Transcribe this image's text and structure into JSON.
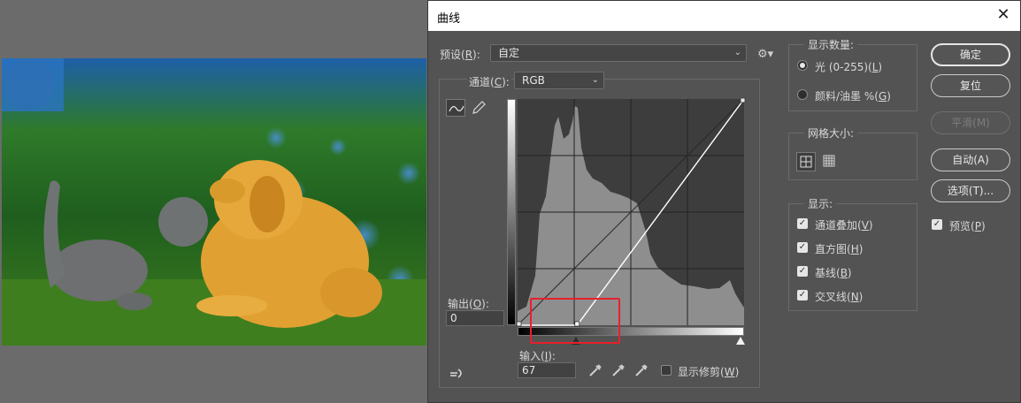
{
  "dialog": {
    "title": "曲线",
    "close_glyph": "✕",
    "preset": {
      "label": "预设(",
      "key": "R",
      "label_end": "):",
      "value": "自定"
    },
    "channel": {
      "label": "通道(",
      "key": "C",
      "label_end": "):",
      "value": "RGB"
    },
    "output": {
      "label": "输出(",
      "key": "O",
      "label_end": "):",
      "value": "0"
    },
    "input": {
      "label": "输入(",
      "key": "I",
      "label_end": "):",
      "value": "67"
    },
    "show_clipping": {
      "label": "显示修剪(",
      "key": "W",
      "label_end": ")",
      "checked": false
    },
    "display_amount": {
      "title": "显示数量:",
      "options": [
        {
          "label": "光 (0-255)(",
          "key": "L",
          "label_end": ")",
          "selected": true
        },
        {
          "label": "颜料/油墨 %(",
          "key": "G",
          "label_end": ")",
          "selected": false
        }
      ]
    },
    "grid_size": {
      "title": "网格大小:"
    },
    "show": {
      "title": "显示:",
      "items": [
        {
          "label": "通道叠加(",
          "key": "V",
          "label_end": ")",
          "checked": true
        },
        {
          "label": "直方图(",
          "key": "H",
          "label_end": ")",
          "checked": true
        },
        {
          "label": "基线(",
          "key": "B",
          "label_end": ")",
          "checked": true
        },
        {
          "label": "交叉线(",
          "key": "N",
          "label_end": ")",
          "checked": true
        }
      ]
    },
    "buttons": {
      "ok": "确定",
      "reset": "复位",
      "smooth": "平滑(M)",
      "auto": "自动(A)",
      "options": "选项(T)..."
    },
    "preview": {
      "label": "预览(",
      "key": "P",
      "label_end": ")",
      "checked": true
    },
    "curve": {
      "points": [
        [
          0,
          0
        ],
        [
          67,
          0
        ],
        [
          255,
          255
        ]
      ],
      "input_value": 67,
      "output_value": 0
    },
    "colors": {
      "accent_red": "#e8202a"
    }
  }
}
